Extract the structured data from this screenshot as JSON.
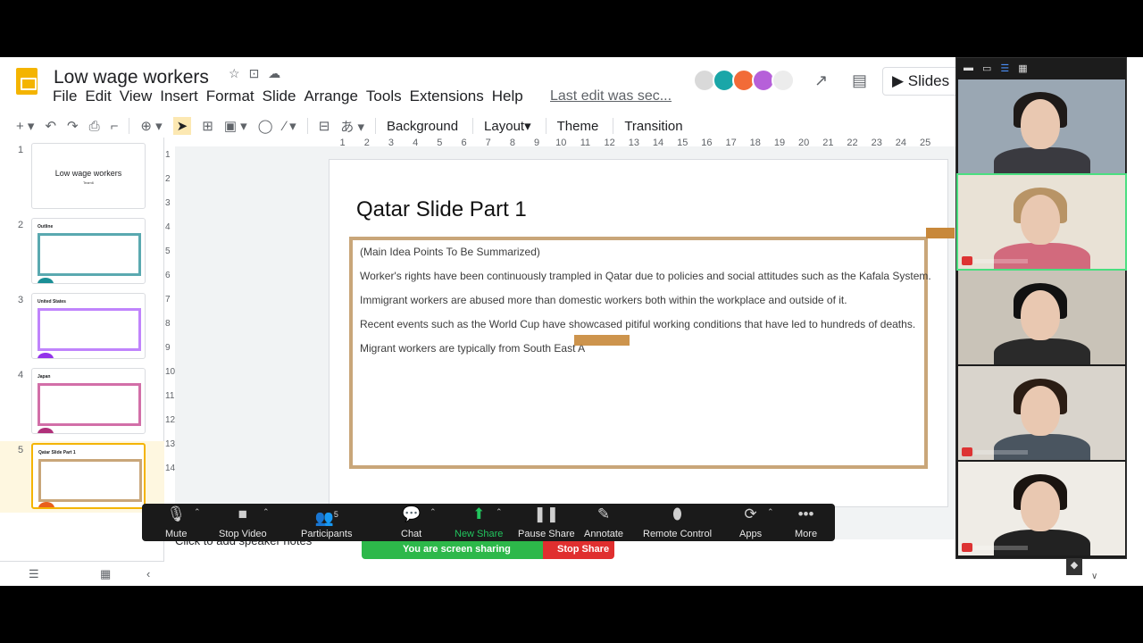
{
  "app": {
    "doc_title": "Low wage workers",
    "menu": [
      "File",
      "Edit",
      "View",
      "Insert",
      "Format",
      "Slide",
      "Arrange",
      "Tools",
      "Extensions",
      "Help"
    ],
    "last_edit": "Last edit was sec...",
    "slideshow_label": "Slides",
    "avatar_colors": [
      "#d9d9d9",
      "#1aa6a8",
      "#f26b38",
      "#b660d9",
      "#ececec"
    ]
  },
  "toolbar": {
    "background": "Background",
    "layout": "Layout",
    "theme": "Theme",
    "transition": "Transition"
  },
  "ruler_h": [
    "1",
    "2",
    "3",
    "4",
    "5",
    "6",
    "7",
    "8",
    "9",
    "10",
    "11",
    "12",
    "13",
    "14",
    "15",
    "16",
    "17",
    "18",
    "19",
    "20",
    "21",
    "22",
    "23",
    "24",
    "25"
  ],
  "ruler_v": [
    "1",
    "2",
    "3",
    "4",
    "5",
    "6",
    "7",
    "8",
    "9",
    "10",
    "11",
    "12",
    "13",
    "14"
  ],
  "filmstrip": [
    {
      "num": "1",
      "title": "Low wage workers",
      "subtitle": "Team6",
      "box_color": "",
      "blob_color": ""
    },
    {
      "num": "2",
      "title": "Outline",
      "subtitle": "",
      "box_color": "#5aa9b0",
      "blob_color": "#1a8f96"
    },
    {
      "num": "3",
      "title": "United States",
      "subtitle": "",
      "box_color": "#c084fc",
      "blob_color": "#9333ea"
    },
    {
      "num": "4",
      "title": "Japan",
      "subtitle": "",
      "box_color": "#d26fa8",
      "blob_color": "#b0307a"
    },
    {
      "num": "5",
      "title": "Qatar Slide Part 1",
      "subtitle": "",
      "box_color": "#c9a679",
      "blob_color": "#e8601c"
    }
  ],
  "slide": {
    "title": "Qatar Slide Part 1",
    "lines": [
      "(Main Idea Points To Be Summarized)",
      "Worker's rights have been continuously trampled in Qatar due to policies and social attitudes such as the Kafala System.",
      "Immigrant workers are abused more than domestic workers both within the workplace and outside of it.",
      "Recent events such as the World Cup have showcased pitiful working conditions that have led to hundreds of deaths.",
      "Migrant workers are typically from South East A"
    ]
  },
  "speaker_notes": "Click to add speaker notes",
  "zoom": {
    "buttons": [
      {
        "name": "mute",
        "label": "Mute"
      },
      {
        "name": "stop-video",
        "label": "Stop Video"
      },
      {
        "name": "participants",
        "label": "Participants"
      },
      {
        "name": "chat",
        "label": "Chat"
      },
      {
        "name": "new-share",
        "label": "New Share"
      },
      {
        "name": "pause-share",
        "label": "Pause Share"
      },
      {
        "name": "annotate",
        "label": "Annotate"
      },
      {
        "name": "remote-control",
        "label": "Remote Control"
      },
      {
        "name": "apps",
        "label": "Apps"
      },
      {
        "name": "more",
        "label": "More"
      }
    ],
    "participants_count": "5",
    "sharing_text": "You are screen sharing",
    "stop_share": "Stop Share"
  },
  "gallery_tiles": [
    {
      "bg": "#9aa7b3",
      "hair": "#1e1a18",
      "body": "#3a3a40",
      "muted": false
    },
    {
      "bg": "#e9e2d6",
      "hair": "#b89466",
      "body": "#d26a7d",
      "muted": true
    },
    {
      "bg": "#c9c3b8",
      "hair": "#111",
      "body": "#2a2a2a",
      "muted": false
    },
    {
      "bg": "#d9d4cc",
      "hair": "#2b1d14",
      "body": "#4a5560",
      "muted": true
    },
    {
      "bg": "#efece6",
      "hair": "#1a1410",
      "body": "#222",
      "muted": true
    }
  ]
}
